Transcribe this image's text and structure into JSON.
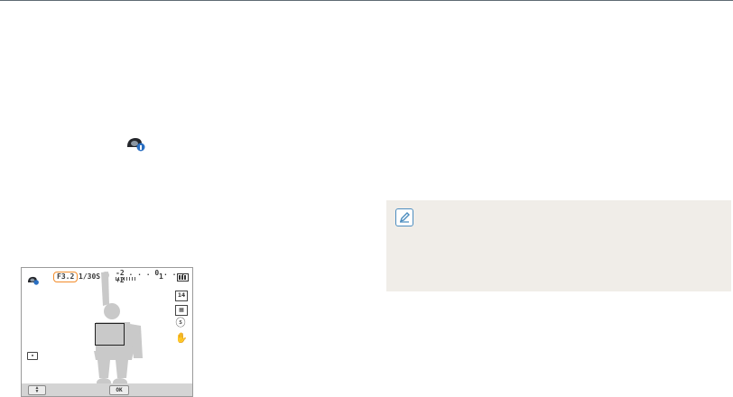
{
  "page": {
    "mode_icon": "smart-auto-camera-icon"
  },
  "lcd": {
    "aperture": "F3.2",
    "shutter_speed": "1/30S",
    "ev_scale": "-2 . . . 0 . . . +2",
    "shot_count": "1",
    "scene_icon": "smart-auto-camera-icon",
    "side_icons": [
      "photo-size-icon",
      "quality-icon",
      "flash-icon",
      "ois-hand-icon"
    ],
    "ok_label": "OK",
    "nav_label": "▲\n▼",
    "colors": {
      "aperture_highlight": "#f28c2a",
      "silhouette": "#c9c9c9",
      "bottom_bar": "#d4d4d4"
    }
  },
  "note": {
    "icon": "note-pencil-icon",
    "colors": {
      "background": "#f0ede8",
      "icon_border": "#4c8dbf"
    }
  }
}
